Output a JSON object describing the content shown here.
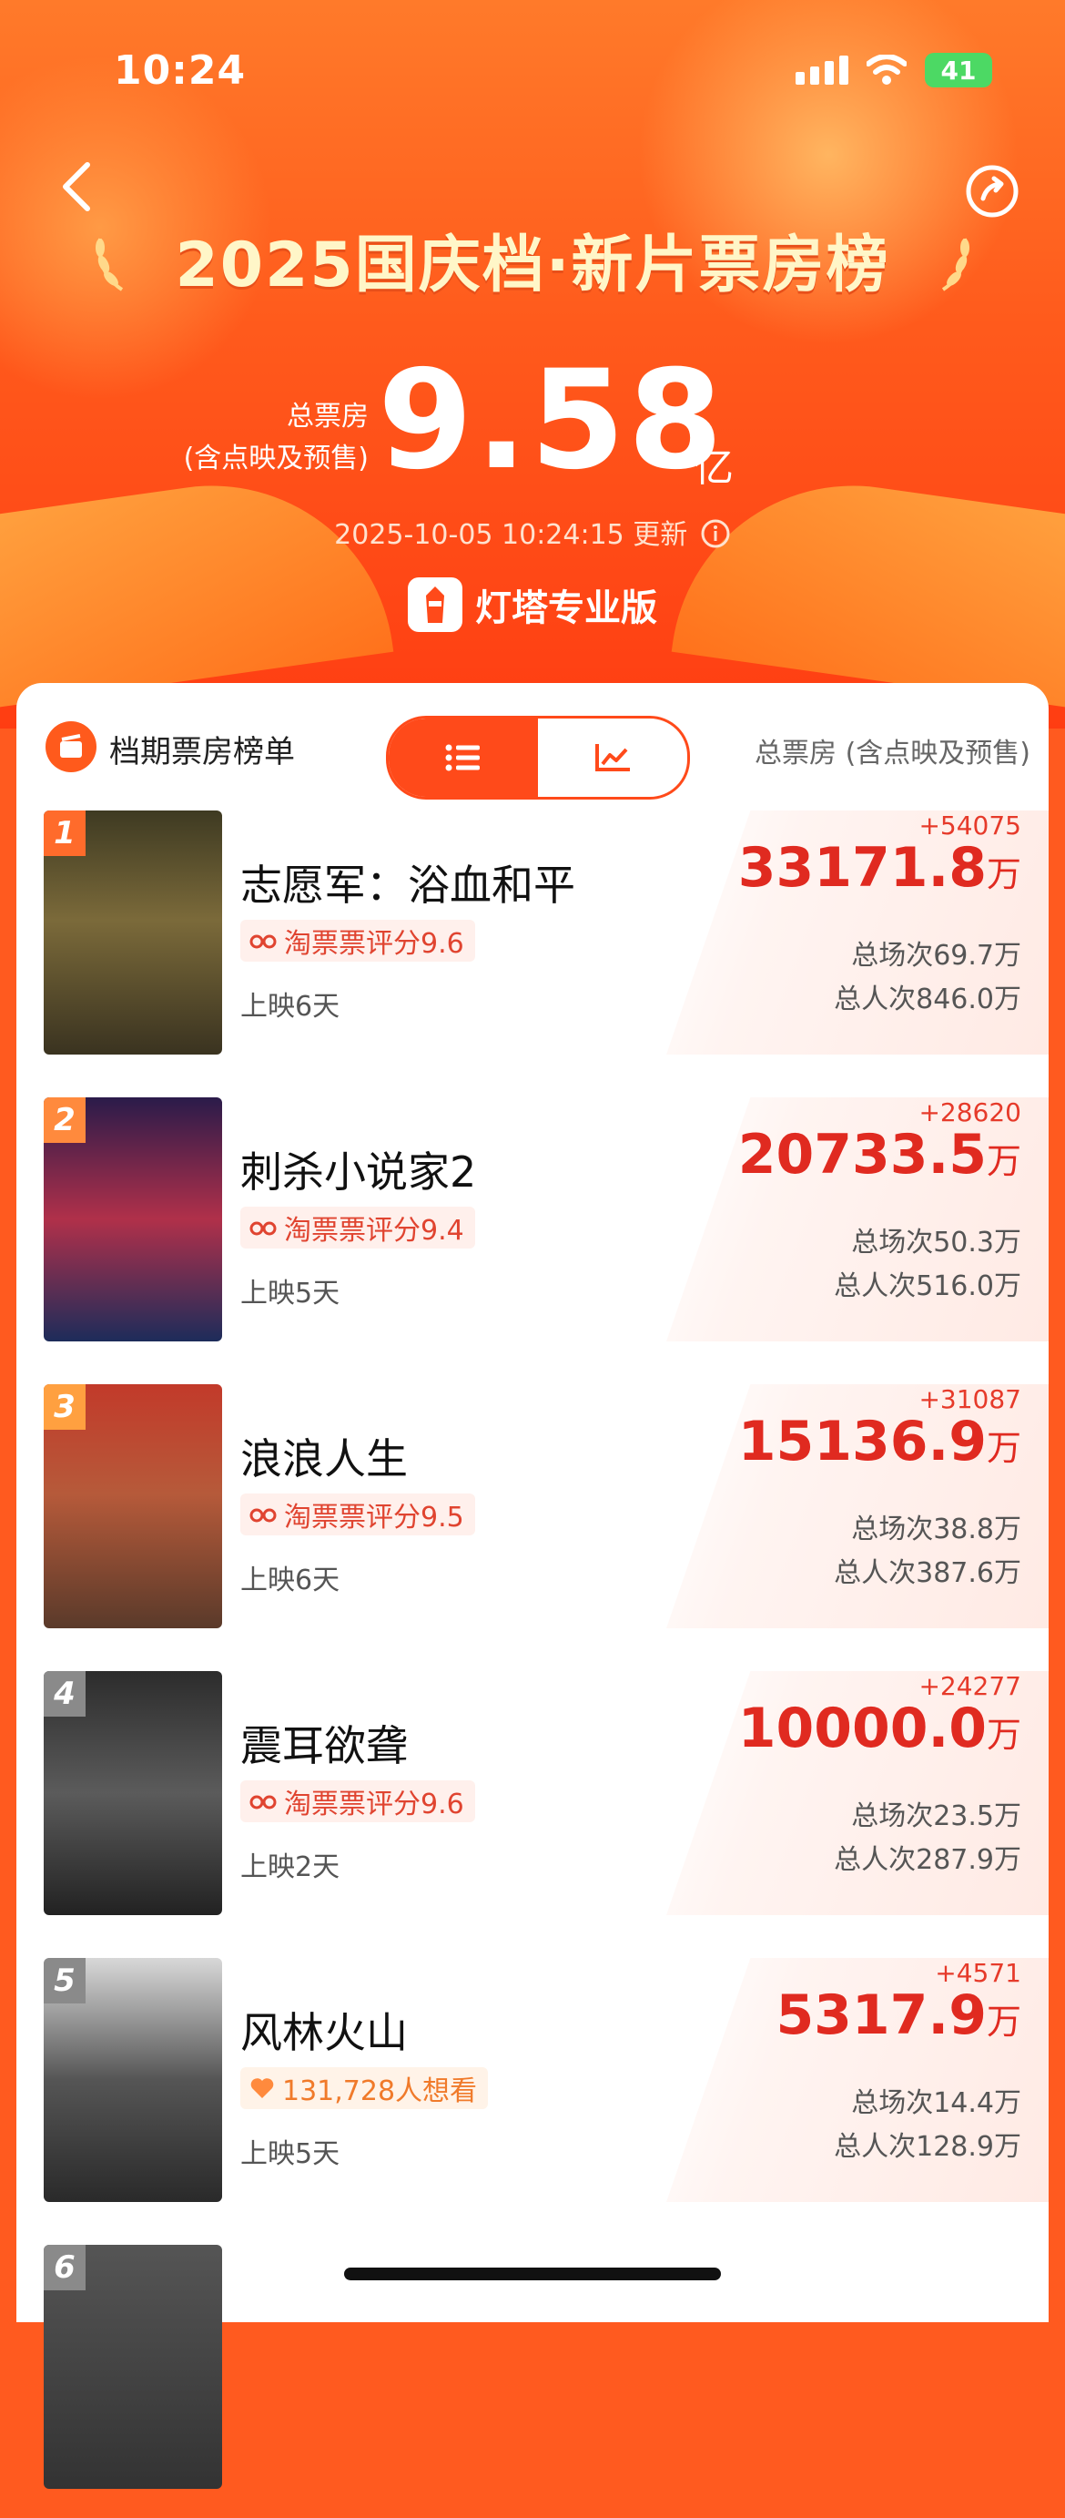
{
  "status_bar": {
    "time": "10:24",
    "battery": "41"
  },
  "header": {
    "title": "2025国庆档·新片票房榜",
    "total_label_line1": "总票房",
    "total_label_line2": "(含点映及预售)",
    "total_value": "9.58",
    "total_unit": "亿",
    "updated": "2025-10-05 10:24:15 更新",
    "brand": "灯塔专业版"
  },
  "card": {
    "title": "档期票房榜单",
    "subtitle": "总票房 (含点映及预售)",
    "view_toggle": [
      "list-icon",
      "trend-chart-icon"
    ]
  },
  "movies": [
    {
      "rank": "1",
      "name": "志愿军：浴血和平",
      "tag": "淘票票评分9.6",
      "days": "上映6天",
      "delta": "+54075",
      "box": "33171.8",
      "unit": "万",
      "shows": "总场次69.7万",
      "people": "总人次846.0万",
      "rank_color": "#ff6b2b"
    },
    {
      "rank": "2",
      "name": "刺杀小说家2",
      "tag": "淘票票评分9.4",
      "days": "上映5天",
      "delta": "+28620",
      "box": "20733.5",
      "unit": "万",
      "shows": "总场次50.3万",
      "people": "总人次516.0万",
      "rank_color": "#ff8a3d"
    },
    {
      "rank": "3",
      "name": "浪浪人生",
      "tag": "淘票票评分9.5",
      "days": "上映6天",
      "delta": "+31087",
      "box": "15136.9",
      "unit": "万",
      "shows": "总场次38.8万",
      "people": "总人次387.6万",
      "rank_color": "#ffa040"
    },
    {
      "rank": "4",
      "name": "震耳欲聋",
      "tag": "淘票票评分9.6",
      "days": "上映2天",
      "delta": "+24277",
      "box": "10000.0",
      "unit": "万",
      "shows": "总场次23.5万",
      "people": "总人次287.9万",
      "rank_color": "#8a8a8a"
    },
    {
      "rank": "5",
      "name": "风林火山",
      "tag": "131,728人想看",
      "days": "上映5天",
      "delta": "+4571",
      "box": "5317.9",
      "unit": "万",
      "shows": "总场次14.4万",
      "people": "总人次128.9万",
      "rank_color": "#8a8a8a"
    },
    {
      "rank": "6",
      "rank_color": "#8a8a8a"
    }
  ]
}
